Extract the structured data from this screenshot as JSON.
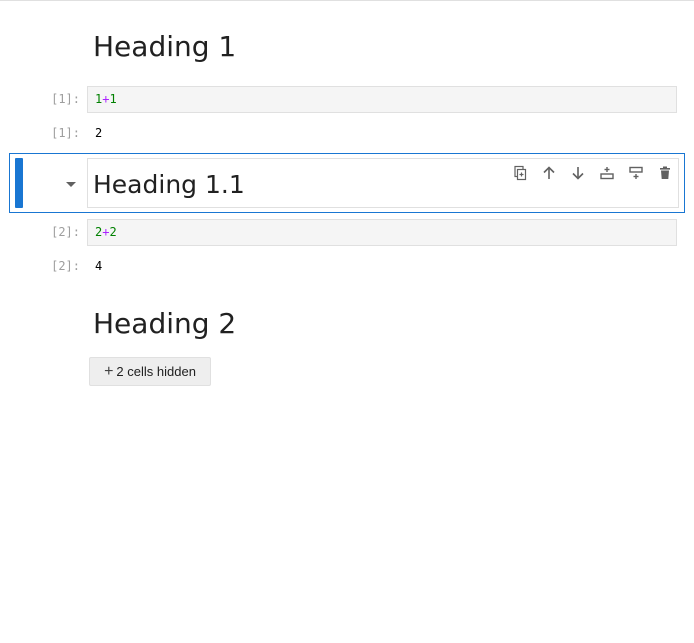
{
  "cells": {
    "heading1": "Heading 1",
    "code1": {
      "prompt": "[1]:",
      "left": "1",
      "op": "+",
      "right": "1"
    },
    "output1": {
      "prompt": "[1]:",
      "value": "2"
    },
    "heading11": "Heading 1.1",
    "code2": {
      "prompt": "[2]:",
      "left": "2",
      "op": "+",
      "right": "2"
    },
    "output2": {
      "prompt": "[2]:",
      "value": "4"
    },
    "heading2": "Heading 2",
    "hidden_button": {
      "icon": "plus-icon",
      "label": "2 cells hidden"
    }
  },
  "toolbar": {
    "icons": [
      "duplicate-icon",
      "move-up-icon",
      "move-down-icon",
      "insert-above-icon",
      "insert-below-icon",
      "delete-icon"
    ]
  },
  "colors": {
    "accent": "#1976d2",
    "number": "#008000",
    "operator": "#aa22ff",
    "prompt": "#9e9e9e"
  }
}
